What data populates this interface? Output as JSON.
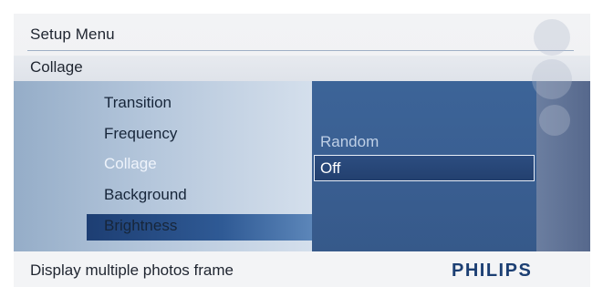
{
  "screen": {
    "title": "Setup Menu",
    "breadcrumb": "Collage"
  },
  "menu": {
    "items": [
      "Transition",
      "Frequency",
      "Collage",
      "Background",
      "Brightness"
    ],
    "selected": "Collage"
  },
  "options": {
    "items": [
      "Random",
      "Off"
    ],
    "selected": "Off"
  },
  "footer": {
    "hint": "Display multiple photos frame",
    "brand": "PHILIPS"
  },
  "controls": {
    "icons": [
      "grid-icon",
      "dpad-icon",
      "back-icon"
    ]
  },
  "colors": {
    "brand": "#1c3f73",
    "highlight": "#2f5a95",
    "option_panel": "#3a5f92"
  }
}
